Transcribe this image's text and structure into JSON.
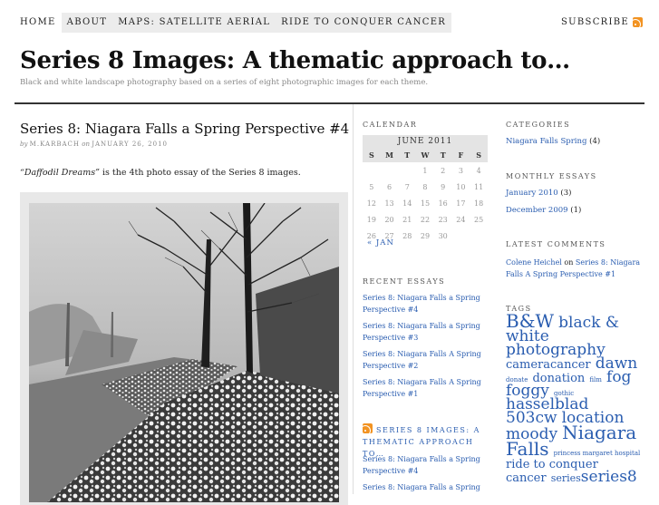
{
  "nav": {
    "home": "HOME",
    "about": "ABOUT",
    "maps": "MAPS: SATELLITE AERIAL",
    "ride": "RIDE TO CONQUER CANCER",
    "subscribe": "SUBSCRIBE"
  },
  "site": {
    "title": "Series 8 Images: A thematic approach to…",
    "description": "Black and white landscape photography based on a series of eight photographic images for each theme."
  },
  "post": {
    "title": "Series 8: Niagara Falls a Spring Perspective #4",
    "meta_by": "by ",
    "meta_author": "M.KARBACH",
    "meta_on": " on ",
    "meta_date": "JANUARY 26, 2010",
    "intro_italic": "“Daffodil Dreams”",
    "intro_rest": " is the 4th photo essay of the Series 8 images."
  },
  "calendar": {
    "heading": "Calendar",
    "month": "JUNE 2011",
    "days": [
      "S",
      "M",
      "T",
      "W",
      "T",
      "F",
      "S"
    ],
    "weeks": [
      [
        "",
        "",
        "",
        "1",
        "2",
        "3",
        "4"
      ],
      [
        "5",
        "6",
        "7",
        "8",
        "9",
        "10",
        "11"
      ],
      [
        "12",
        "13",
        "14",
        "15",
        "16",
        "17",
        "18"
      ],
      [
        "19",
        "20",
        "21",
        "22",
        "23",
        "24",
        "25"
      ],
      [
        "26",
        "27",
        "28",
        "29",
        "30",
        "",
        ""
      ]
    ],
    "prev": "« JAN"
  },
  "recent": {
    "heading": "Recent Essays",
    "items": [
      "Series 8: Niagara Falls a Spring Perspective #4",
      "Series 8: Niagara Falls a Spring Perspective #3",
      "Series 8: Niagara Falls A Spring Perspective #2",
      "Series 8: Niagara Falls A Spring Perspective #1"
    ]
  },
  "feed": {
    "heading": "Series 8 Images: A thematic approach to…",
    "items": [
      "Series 8: Niagara Falls a Spring Perspective #4",
      "Series 8: Niagara Falls a Spring"
    ]
  },
  "categories": {
    "heading": "Categories",
    "name": "Niagara Falls Spring",
    "count": " (4)"
  },
  "monthly": {
    "heading": "Monthly Essays",
    "items": [
      {
        "name": "January 2010",
        "count": " (3)"
      },
      {
        "name": "December 2009",
        "count": " (1)"
      }
    ]
  },
  "comments": {
    "heading": "Latest Comments",
    "author": "Colene Heichel",
    "on": " on ",
    "post": "Series 8: Niagara Falls A Spring Perspective #1"
  },
  "tags": {
    "heading": "Tags",
    "items": [
      "B&W",
      "black & white photography",
      "camera",
      "cancer",
      "dawn",
      "donate",
      "donation",
      "film",
      "fog",
      "foggy",
      "gothic",
      "hasselblad 503cw",
      "location",
      "moody",
      "Niagara Falls",
      "princess margaret hospital",
      "ride to conquer",
      "cancer",
      "series",
      "series8"
    ]
  },
  "colors": {
    "link": "#2a5db0",
    "rss": "#f29322",
    "nav_box": "#ececec"
  }
}
